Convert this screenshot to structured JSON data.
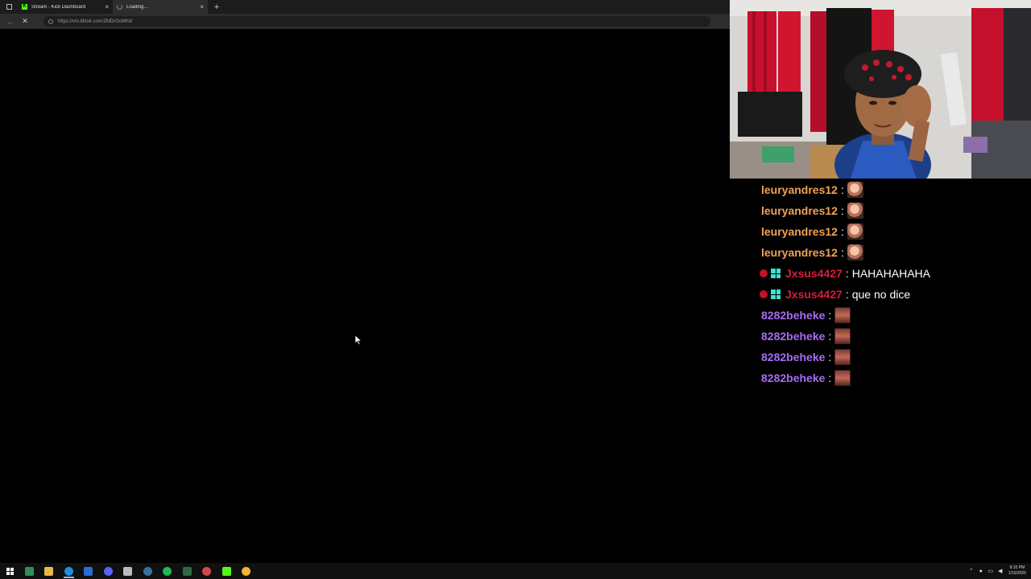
{
  "browser": {
    "tabs": [
      {
        "title": "Stream - Kick Dashboard",
        "favicon": "kick-icon",
        "active": false
      },
      {
        "title": "Loading...",
        "favicon": "loading-spinner-icon",
        "active": true
      }
    ],
    "new_tab_symbol": "+",
    "close_symbol": "×",
    "url": "https://vm.tiktok.com/ZMDrGoMh3/",
    "back_symbol": "←",
    "stop_symbol": "✕"
  },
  "chat": {
    "messages": [
      {
        "user": "leuryandres12",
        "color": "#f2a154",
        "text": "",
        "emote": "face",
        "badges": false
      },
      {
        "user": "leuryandres12",
        "color": "#f2a154",
        "text": "",
        "emote": "face",
        "badges": false
      },
      {
        "user": "leuryandres12",
        "color": "#f2a154",
        "text": "",
        "emote": "face",
        "badges": false
      },
      {
        "user": "leuryandres12",
        "color": "#f2a154",
        "text": "",
        "emote": "face",
        "badges": false
      },
      {
        "user": "Jxsus4427",
        "color": "#d81b3c",
        "text": "HAHAHAHAHA",
        "emote": "",
        "badges": true
      },
      {
        "user": "Jxsus4427",
        "color": "#d81b3c",
        "text": "que no dice",
        "emote": "",
        "badges": true
      },
      {
        "user": "8282beheke",
        "color": "#a66cf2",
        "text": "",
        "emote": "guy",
        "badges": false
      },
      {
        "user": "8282beheke",
        "color": "#a66cf2",
        "text": "",
        "emote": "guy",
        "badges": false
      },
      {
        "user": "8282beheke",
        "color": "#a66cf2",
        "text": "",
        "emote": "guy",
        "badges": false
      },
      {
        "user": "8282beheke",
        "color": "#a66cf2",
        "text": "",
        "emote": "guy",
        "badges": false
      }
    ]
  },
  "taskbar": {
    "apps": [
      {
        "name": "terminal-icon",
        "color": "#2f8f5a"
      },
      {
        "name": "file-explorer-icon",
        "color": "#e8b84a"
      },
      {
        "name": "edge-icon",
        "color": "#1e90d8"
      },
      {
        "name": "app-blue-icon",
        "color": "#2a6cd6"
      },
      {
        "name": "discord-icon",
        "color": "#5865f2"
      },
      {
        "name": "pen-icon",
        "color": "#bbbbbb"
      },
      {
        "name": "steam-icon",
        "color": "#3a6f9a"
      },
      {
        "name": "spotify-icon",
        "color": "#1db954"
      },
      {
        "name": "app-dark-icon",
        "color": "#2b6b44"
      },
      {
        "name": "obs-icon",
        "color": "#d14a4a"
      },
      {
        "name": "kick-icon",
        "color": "#53fc18"
      },
      {
        "name": "chrome-icon",
        "color": "#f2b233"
      }
    ],
    "active_app_index": 2,
    "clock_time": "8:10 PM",
    "clock_date": "1/15/2026"
  }
}
